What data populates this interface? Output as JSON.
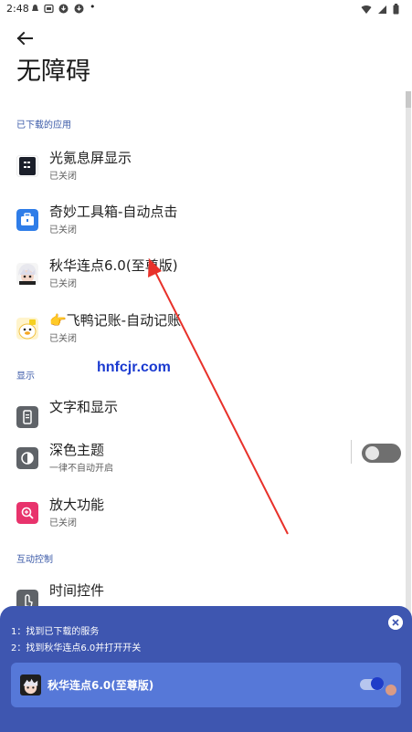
{
  "status_bar": {
    "time": "2:48",
    "dot": "•"
  },
  "header": {
    "title": "无障碍"
  },
  "sections": {
    "downloaded": "已下载的应用",
    "display": "显示",
    "interaction": "互动控制"
  },
  "downloaded_apps": [
    {
      "name": "光氪息屏显示",
      "status": "已关闭",
      "icon": "clock-app-icon"
    },
    {
      "name": "奇妙工具箱-自动点击",
      "status": "已关闭",
      "icon": "toolbox-app-icon"
    },
    {
      "name": "秋华连点6.0(至尊版)",
      "status": "已关闭",
      "icon": "anime-avatar-icon"
    },
    {
      "name": "👉飞鸭记账-自动记账",
      "status": "已关闭",
      "icon": "duck-app-icon"
    }
  ],
  "display_items": [
    {
      "name": "文字和显示",
      "status": ""
    },
    {
      "name": "深色主题",
      "status": "一律不自动开启",
      "toggle_on": false
    },
    {
      "name": "放大功能",
      "status": "已关闭"
    }
  ],
  "interaction_items": [
    {
      "name": "时间控件"
    }
  ],
  "watermark": "hnfcjr.com",
  "guide": {
    "step1": "1：找到已下载的服务",
    "step2": "2：找到秋华连点6.0并打开开关",
    "app_name": "秋华连点6.0(至尊版)",
    "toggle_on": true
  },
  "colors": {
    "accent": "#3b5aa8",
    "sheet": "#3e56b0",
    "card": "#5678d8",
    "arrow": "#e8312a",
    "magnify": "#e8336c"
  }
}
